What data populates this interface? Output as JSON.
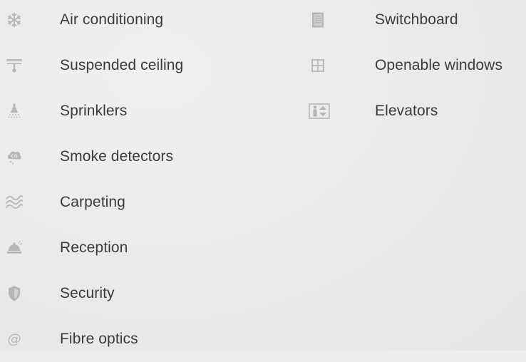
{
  "left_column": {
    "items": [
      {
        "icon": "snowflake-icon",
        "label": "Air conditioning"
      },
      {
        "icon": "ceiling-icon",
        "label": "Suspended ceiling"
      },
      {
        "icon": "sprinkler-icon",
        "label": "Sprinklers"
      },
      {
        "icon": "smoke-detector-icon",
        "label": "Smoke detectors"
      },
      {
        "icon": "carpet-waves-icon",
        "label": "Carpeting"
      },
      {
        "icon": "reception-bell-icon",
        "label": "Reception"
      },
      {
        "icon": "shield-icon",
        "label": "Security"
      },
      {
        "icon": "at-sign-icon",
        "label": "Fibre optics"
      }
    ]
  },
  "right_column": {
    "items": [
      {
        "icon": "switchboard-icon",
        "label": "Switchboard"
      },
      {
        "icon": "window-icon",
        "label": "Openable windows"
      },
      {
        "icon": "elevator-icon",
        "label": "Elevators"
      }
    ]
  },
  "colors": {
    "background": "#ececec",
    "text": "#3b3b3b",
    "icon": "#b4b4b4"
  }
}
